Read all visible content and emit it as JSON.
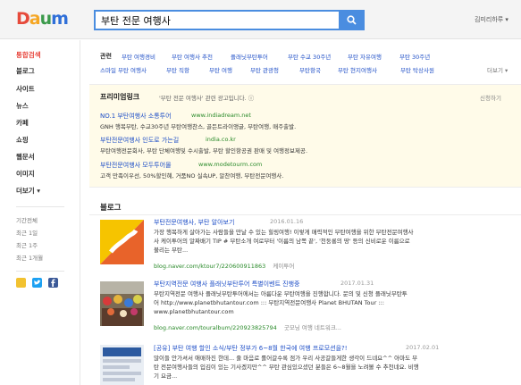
{
  "header": {
    "logo_letters": [
      "D",
      "a",
      "u",
      "m"
    ],
    "logo_colors": [
      "#e64a3b",
      "#f5a623",
      "#3b9a4b",
      "#2f6fd8"
    ],
    "search_value": "부탄 전문 여행사",
    "search_icon": "search-icon",
    "user_link": "김미리하루 ▾"
  },
  "sidebar": {
    "items": [
      {
        "label": "통합검색",
        "active": true
      },
      {
        "label": "블로그"
      },
      {
        "label": "사이트"
      },
      {
        "label": "뉴스"
      },
      {
        "label": "카페"
      },
      {
        "label": "쇼핑"
      },
      {
        "label": "웹문서"
      },
      {
        "label": "이미지"
      },
      {
        "label": "더보기 ▾"
      }
    ],
    "period": [
      "기간전체",
      "최근 1일",
      "최근 1주",
      "최근 1개월"
    ]
  },
  "related": {
    "label": "관련",
    "row1": [
      "부탄 여행경비",
      "부탄 여행사 추천",
      "플래닛부탄투어",
      "부탄 수교 30주년",
      "부탄 자유여행",
      "부탄 30주년"
    ],
    "row2": [
      "스마일 부탄 여행사",
      "부탄 직항",
      "부탄 여행",
      "부탄 관광청",
      "부탄항국",
      "부탄 현지여행사",
      "부탄 탁상사원"
    ],
    "more": "더보기 ▾"
  },
  "premium": {
    "title": "프리미엄링크",
    "note": "'부탄 전문 여행사' 관련 광고입니다. ⓘ",
    "apply": "신청하기",
    "ads": [
      {
        "title": "NO.1 부탄여행사 소통투어",
        "url": "www.indiadream.net",
        "desc": "GNH 행복부탄, 수교30주년 부탄여행찬스, 골든트라이앵글, 부탄여행, 매주출발."
      },
      {
        "title": "부탄전문여행사 인도로 가는길",
        "url": "india.co.kr",
        "desc": "부탄여행전문회사, 부탄 단체여행및 수시출발, 부탄 할인항공권 판매 및 여행정보제공."
      },
      {
        "title": "부탄전문여행사 모두투어몰",
        "url": "www.modetourm.com",
        "desc": "고객 만족이우선, 50%할인혜, 거품NO 실속UP, 알찬여행, 부탄전문여행사."
      }
    ]
  },
  "blog": {
    "heading": "블로그",
    "posts": [
      {
        "title": "부탄전문여행사, 부탄 알아보기",
        "date": "2016.01.16",
        "lines": [
          "가장 행복하게 살아가는 사람들을 만날 수 있는 힐링여행! 이렇게 매력적인 부탄여행을 위한 부탄전문여행사",
          "사 케이투어의 알짜배기 TIP # 부탄소개 여로부터 '이름의 남쪽 끝', '천둥룡의 땅' 등의 신비로운 이름으로",
          "불리는 부탄..."
        ],
        "source": "blog.naver.com/ktour7/220600911863",
        "nick": "케이투어"
      },
      {
        "title": "부탄지역전문 여행사 플래닛부탄투어 특별이벤트 진행중",
        "date": "2017.01.31",
        "lines": [
          "부탄지역전문 여행사 플래닛부탄투어에서는 아름다운 부탄여행을 진행합니다. 문의 및 신청 플래닛부탄투",
          "어 http://www.planetbhutantour.com ::: 부탄지역전문여행사 Planet BHUTAN Tour :::",
          "www.planetbhutantour.com"
        ],
        "source": "blog.naver.com/touralbum/220923825794",
        "nick": "굿모닝 여행 네트워크..."
      },
      {
        "title": "[공유] 부탄 여행 할인 소식/부탄 정부가 6~8월 한국에 여행 프로모션을?!",
        "date": "2017.02.01",
        "lines": [
          "많이들 안가셔서 애매하진 한데... 줄 마음로 롤어갈수록 점가 우리 사공갈들게한 생각이 드네요^^ 아마도 부",
          "탄 전문여행사들의 입김이 있는 기사겠지만^^ 부탄 관심있으셨던 분들은 6~8월을 노려볼 수 추천네요. 비행",
          "기 요금..."
        ],
        "source": "",
        "nick": ""
      }
    ]
  },
  "colors": {
    "accent": "#4a8de0",
    "link": "#1f4fc7",
    "url": "#2a8a2a",
    "active_nav": "#e8473e",
    "premium_bg": "#fffbe9"
  }
}
